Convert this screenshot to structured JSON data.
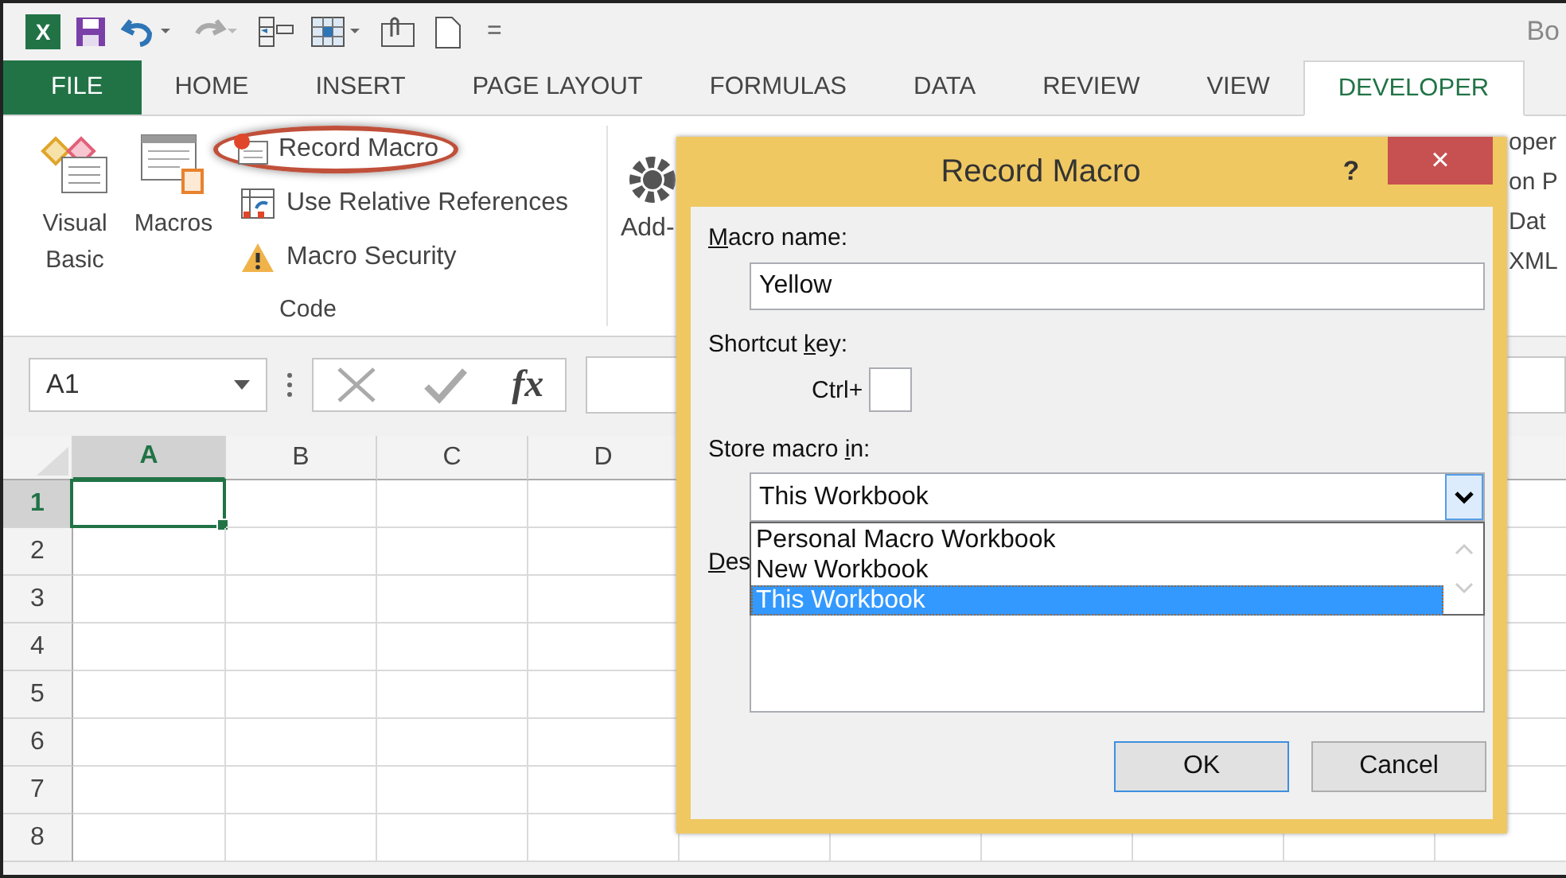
{
  "title_bar": {
    "logo_text": "X",
    "title_partial": "Bo",
    "customize_glyph": "="
  },
  "tabs": [
    {
      "label": "FILE",
      "kind": "file",
      "selected": false
    },
    {
      "label": "HOME",
      "kind": "tab",
      "selected": false
    },
    {
      "label": "INSERT",
      "kind": "tab",
      "selected": false
    },
    {
      "label": "PAGE LAYOUT",
      "kind": "tab",
      "selected": false
    },
    {
      "label": "FORMULAS",
      "kind": "tab",
      "selected": false
    },
    {
      "label": "DATA",
      "kind": "tab",
      "selected": false
    },
    {
      "label": "REVIEW",
      "kind": "tab",
      "selected": false
    },
    {
      "label": "VIEW",
      "kind": "tab",
      "selected": false
    },
    {
      "label": "DEVELOPER",
      "kind": "tab",
      "selected": true
    }
  ],
  "ribbon": {
    "code_group": {
      "label": "Code",
      "large_buttons": [
        {
          "label": "Visual Basic",
          "kind": "vb"
        },
        {
          "label": "Macros",
          "kind": "macros"
        }
      ],
      "small_buttons": [
        {
          "label": "Record Macro",
          "kind": "record",
          "highlighted": true
        },
        {
          "label": "Use Relative References",
          "kind": "relative",
          "highlighted": false
        },
        {
          "label": "Macro Security",
          "kind": "security",
          "highlighted": false
        }
      ]
    },
    "add_ins_partial": "Add-",
    "right_partial": [
      "oper",
      "on P",
      "Dat",
      "XML"
    ]
  },
  "formula_bar": {
    "name_box": "A1",
    "function_label": "fx"
  },
  "grid": {
    "columns": [
      {
        "label": "A",
        "selected": true
      },
      {
        "label": "B",
        "selected": false
      },
      {
        "label": "C",
        "selected": false
      },
      {
        "label": "D",
        "selected": false
      }
    ],
    "rows": [
      {
        "label": "1",
        "selected": true
      },
      {
        "label": "2",
        "selected": false
      },
      {
        "label": "3",
        "selected": false
      },
      {
        "label": "4",
        "selected": false
      },
      {
        "label": "5",
        "selected": false
      },
      {
        "label": "6",
        "selected": false
      },
      {
        "label": "7",
        "selected": false
      },
      {
        "label": "8",
        "selected": false
      }
    ]
  },
  "dialog": {
    "title": "Record Macro",
    "help": "?",
    "close": "×",
    "macro_name_label": {
      "key": "M",
      "after": "acro name:"
    },
    "macro_name_value": "Yellow",
    "shortcut_label": {
      "before": "Shortcut ",
      "key": "k",
      "after": "ey:"
    },
    "ctrl_label": "Ctrl+",
    "store_label": {
      "before": "Store macro ",
      "key": "i",
      "after": "n:"
    },
    "store_value": "This Workbook",
    "store_options": [
      {
        "label": "Personal Macro Workbook",
        "selected": false
      },
      {
        "label": "New Workbook",
        "selected": false
      },
      {
        "label": "This Workbook",
        "selected": true
      }
    ],
    "description_label_partial": {
      "key": "D",
      "after": "es"
    },
    "buttons": [
      {
        "label": "OK",
        "default": true
      },
      {
        "label": "Cancel",
        "default": false
      }
    ]
  }
}
